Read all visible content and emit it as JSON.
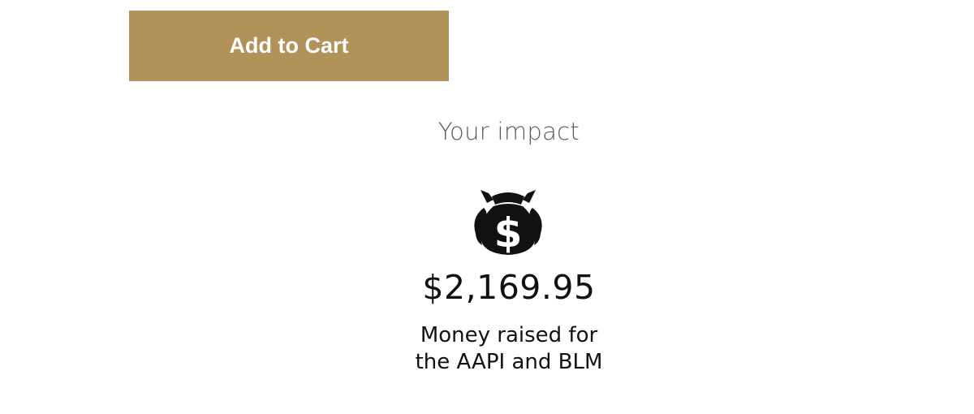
{
  "cart": {
    "add_to_cart_label": "Add to Cart",
    "button_color": "#b1935a"
  },
  "impact": {
    "title": "Your impact",
    "icon": "money-bag-icon",
    "amount": "$2,169.95",
    "caption_line1": "Money raised for",
    "caption_line2": "the AAPI and BLM"
  }
}
